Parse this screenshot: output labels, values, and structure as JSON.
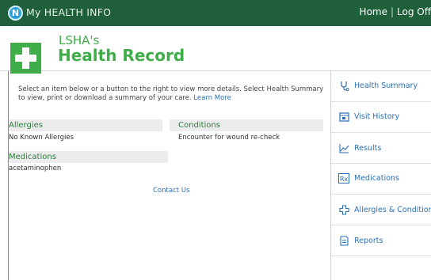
{
  "topbar": {
    "logo_letter": "N",
    "app_title": "My HEALTH INFO",
    "nav_home": "Home",
    "nav_separator": "|",
    "nav_logoff": "Log Off"
  },
  "header": {
    "org_name": "LSHA's",
    "record_title": "Health Record"
  },
  "main": {
    "intro_text": "Select an item below or a button to the right to view more details. Select Health Summary to view, print or download a summary of your care.",
    "learn_more": "Learn More",
    "sections": {
      "allergies": {
        "title": "Allergies",
        "value": "No Known Allergies"
      },
      "conditions": {
        "title": "Conditions",
        "value": "Encounter for wound re-check"
      },
      "medications": {
        "title": "Medications",
        "value": "acetaminophen"
      }
    },
    "contact_link": "Contact Us"
  },
  "sidebar": {
    "items": [
      {
        "label": "Health Summary",
        "icon": "stethoscope-icon"
      },
      {
        "label": "Visit History",
        "icon": "calendar-icon"
      },
      {
        "label": "Results",
        "icon": "line-chart-icon"
      },
      {
        "label": "Medications",
        "icon": "rx-icon"
      },
      {
        "label": "Allergies & Conditions",
        "icon": "medical-cross-icon"
      },
      {
        "label": "Reports",
        "icon": "document-icon"
      }
    ]
  },
  "colors": {
    "topbar": "#1f5f3a",
    "brand_green": "#3fae49",
    "link_blue": "#2a6fb3",
    "section_header_bg": "#ececec"
  }
}
